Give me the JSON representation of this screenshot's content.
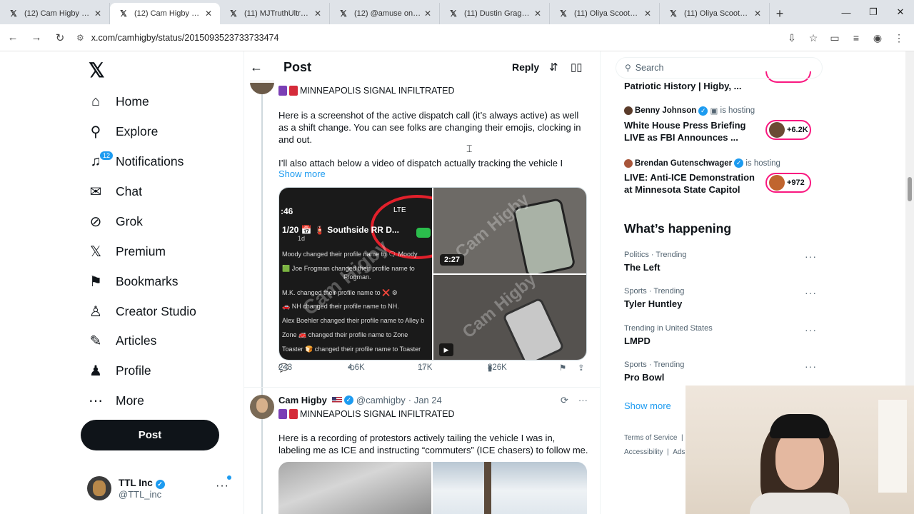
{
  "browser": {
    "tabs": [
      {
        "title": "(12) Cam Higby us on"
      },
      {
        "title": "(12) Cam Higby us on"
      },
      {
        "title": "(11) MJTruthUltra on"
      },
      {
        "title": "(12) @amuse on X: \"I"
      },
      {
        "title": "(11) Dustin Grage on"
      },
      {
        "title": "(11) Oliya Scootercas"
      },
      {
        "title": "(11) Oliya Scootercas"
      }
    ],
    "url": "x.com/camhigby/status/2015093523733733474"
  },
  "nav": {
    "items": [
      {
        "label": "Home"
      },
      {
        "label": "Explore"
      },
      {
        "label": "Notifications",
        "badge": "12"
      },
      {
        "label": "Chat"
      },
      {
        "label": "Grok"
      },
      {
        "label": "Premium"
      },
      {
        "label": "Bookmarks"
      },
      {
        "label": "Creator Studio"
      },
      {
        "label": "Articles"
      },
      {
        "label": "Profile"
      },
      {
        "label": "More"
      }
    ],
    "post_label": "Post",
    "account": {
      "name": "TTL Inc",
      "handle": "@TTL_inc"
    }
  },
  "header": {
    "title": "Post",
    "reply_label": "Reply"
  },
  "tweet1": {
    "headline": "MINNEAPOLIS SIGNAL INFILTRATED",
    "para1": "Here is a screenshot of the active dispatch call (it’s always active) as well as a shift change. You can see folks are changing their emojis, clocking in and out.",
    "para2": "I’ll also attach below a video of dispatch actually tracking the vehicle I",
    "show_more": "Show more",
    "media": {
      "clock": ":46",
      "lte": "LTE",
      "group": "1/20 📅 🧯 Southside RR D...",
      "group_sub": "1d",
      "chat_lines": [
        "Moody changed their profile name to 🗨 Moody",
        "🟩 Joe Frogman changed their profile name to",
        "Frogman.",
        "M.K. changed their profile name to ❌ ⚙",
        "🚗 NH changed their profile name to NH.",
        "Alex Boehler changed their profile name to Alley b",
        "Zone 🚒 changed their profile name to Zone",
        "Toaster 🍞 changed their profile name to Toaster"
      ],
      "video_duration": "2:27",
      "watermark": "Cam Higby"
    },
    "stats": {
      "replies": "243",
      "reposts": "4.6K",
      "likes": "17K",
      "views": "826K"
    }
  },
  "tweet2": {
    "name": "Cam Higby",
    "handle": "@camhigby",
    "date": "· Jan 24",
    "headline": "MINNEAPOLIS SIGNAL INFILTRATED",
    "text": "Here is a recording of protestors actively tailing the vehicle I was in, labeling me as ICE and instructing “commuters” (ICE chasers) to follow me."
  },
  "sidebar": {
    "search_placeholder": "Search",
    "spaces": [
      {
        "title": "Patriotic History | Higby, ..."
      },
      {
        "host": "Benny Johnson",
        "status": "is hosting",
        "title": "White House Press Briefing LIVE as FBI Announces ...",
        "count": "+6.2K"
      },
      {
        "host": "Brendan Gutenschwager",
        "status": "is hosting",
        "title": "LIVE: Anti-ICE Demonstration at Minnesota State Capitol",
        "count": "+972"
      }
    ],
    "whats_happening": "What’s happening",
    "trends": [
      {
        "category": "Politics · Trending",
        "name": "The Left"
      },
      {
        "category": "Sports · Trending",
        "name": "Tyler Huntley"
      },
      {
        "category": "Trending in United States",
        "name": "LMPD"
      },
      {
        "category": "Sports · Trending",
        "name": "Pro Bowl"
      }
    ],
    "show_more": "Show more",
    "footer": {
      "terms": "Terms of Service",
      "accessibility": "Accessibility",
      "ads": "Ads"
    }
  },
  "colors": {
    "accent": "#1d9bf0",
    "live_ring": "#f91880",
    "text": "#0f1419",
    "muted": "#536471"
  }
}
